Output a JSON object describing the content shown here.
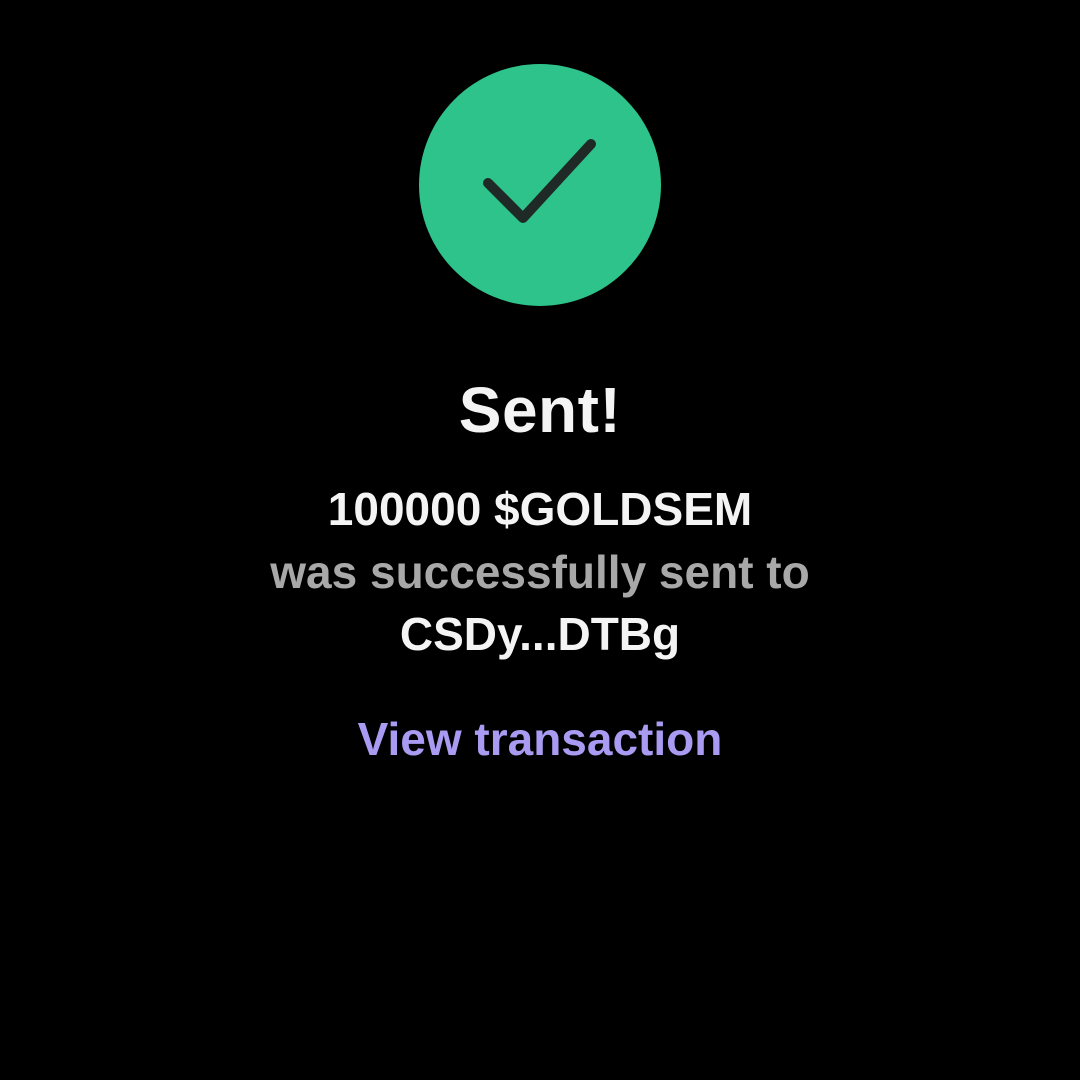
{
  "status": {
    "icon": "checkmark-icon",
    "title": "Sent!",
    "amount_text": "100000 $GOLDSEM",
    "message": "was successfully sent to",
    "recipient": "CSDy...DTBg"
  },
  "actions": {
    "view_transaction_label": "View transaction"
  },
  "colors": {
    "background": "#000000",
    "success": "#2ec38a",
    "check_stroke": "#1f2a27",
    "link": "#a99af2",
    "secondary_text": "#a8a8a8",
    "primary_text": "#f4f4f4"
  }
}
